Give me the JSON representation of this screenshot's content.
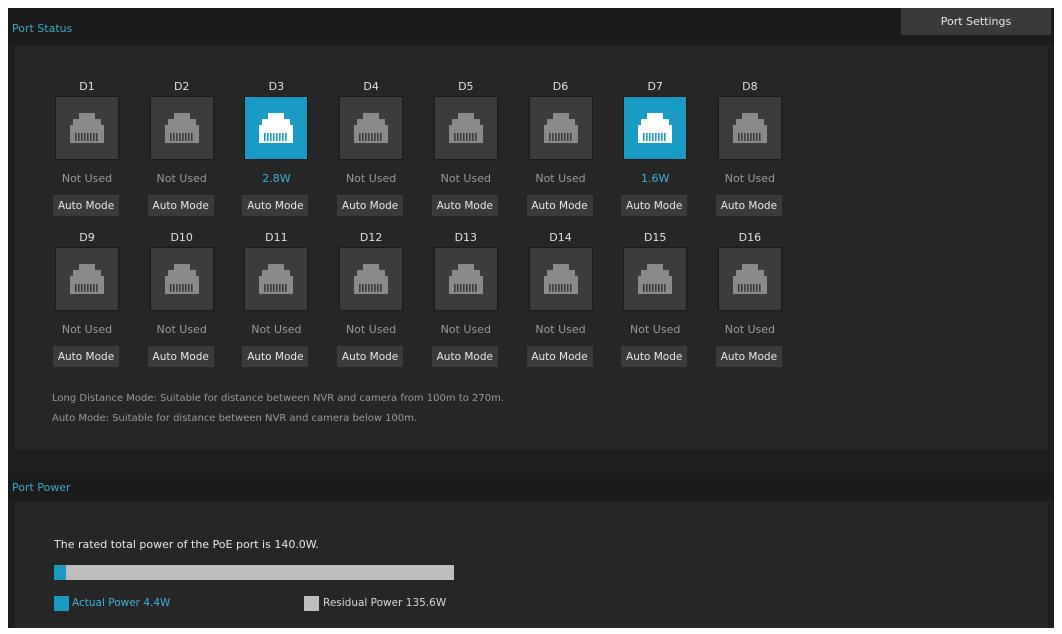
{
  "colors": {
    "accent": "#1a9bc4",
    "background": "#1e1e1e",
    "panel": "#262626",
    "residual": "#bdbdbd"
  },
  "header": {
    "port_settings_label": "Port Settings"
  },
  "port_status": {
    "title": "Port Status",
    "ports": [
      {
        "label": "D1",
        "status": "Not Used",
        "mode": "Auto Mode",
        "active": false
      },
      {
        "label": "D2",
        "status": "Not Used",
        "mode": "Auto Mode",
        "active": false
      },
      {
        "label": "D3",
        "status": "2.8W",
        "mode": "Auto Mode",
        "active": true
      },
      {
        "label": "D4",
        "status": "Not Used",
        "mode": "Auto Mode",
        "active": false
      },
      {
        "label": "D5",
        "status": "Not Used",
        "mode": "Auto Mode",
        "active": false
      },
      {
        "label": "D6",
        "status": "Not Used",
        "mode": "Auto Mode",
        "active": false
      },
      {
        "label": "D7",
        "status": "1.6W",
        "mode": "Auto Mode",
        "active": true
      },
      {
        "label": "D8",
        "status": "Not Used",
        "mode": "Auto Mode",
        "active": false
      },
      {
        "label": "D9",
        "status": "Not Used",
        "mode": "Auto Mode",
        "active": false
      },
      {
        "label": "D10",
        "status": "Not Used",
        "mode": "Auto Mode",
        "active": false
      },
      {
        "label": "D11",
        "status": "Not Used",
        "mode": "Auto Mode",
        "active": false
      },
      {
        "label": "D12",
        "status": "Not Used",
        "mode": "Auto Mode",
        "active": false
      },
      {
        "label": "D13",
        "status": "Not Used",
        "mode": "Auto Mode",
        "active": false
      },
      {
        "label": "D14",
        "status": "Not Used",
        "mode": "Auto Mode",
        "active": false
      },
      {
        "label": "D15",
        "status": "Not Used",
        "mode": "Auto Mode",
        "active": false
      },
      {
        "label": "D16",
        "status": "Not Used",
        "mode": "Auto Mode",
        "active": false
      }
    ],
    "notes": [
      "Long Distance Mode: Suitable for distance between NVR and camera from 100m to 270m.",
      "Auto Mode: Suitable for distance between NVR and camera below 100m."
    ]
  },
  "port_power": {
    "title": "Port Power",
    "rated_text": "The rated total power of the PoE port is 140.0W.",
    "usage_fraction": 0.031,
    "actual_label": "Actual Power 4.4W",
    "residual_label": "Residual Power 135.6W"
  }
}
